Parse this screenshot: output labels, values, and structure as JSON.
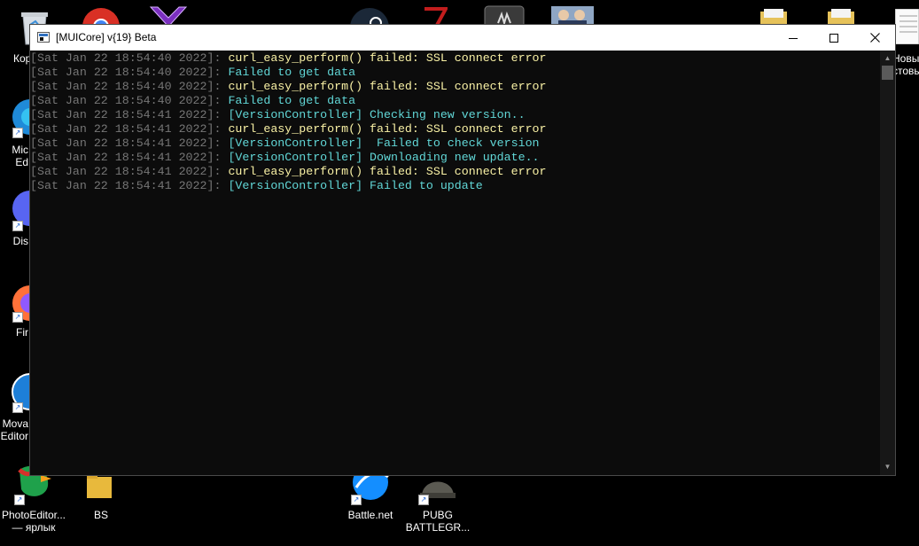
{
  "window": {
    "title": "[MUICore] v{19} Beta"
  },
  "console": {
    "lines": [
      {
        "ts": "[Sat Jan 22 18:54:40 2022]",
        "sep": ": ",
        "msg": "curl_easy_perform() failed: SSL connect error",
        "kind": "warn"
      },
      {
        "ts": "[Sat Jan 22 18:54:40 2022]",
        "sep": ": ",
        "msg": "Failed to get data",
        "kind": "info"
      },
      {
        "ts": "[Sat Jan 22 18:54:40 2022]",
        "sep": ": ",
        "msg": "curl_easy_perform() failed: SSL connect error",
        "kind": "warn"
      },
      {
        "ts": "[Sat Jan 22 18:54:40 2022]",
        "sep": ": ",
        "msg": "Failed to get data",
        "kind": "info"
      },
      {
        "ts": "[Sat Jan 22 18:54:41 2022]",
        "sep": ": ",
        "msg": "[VersionController] Checking new version..",
        "kind": "info"
      },
      {
        "ts": "[Sat Jan 22 18:54:41 2022]",
        "sep": ": ",
        "msg": "curl_easy_perform() failed: SSL connect error",
        "kind": "warn"
      },
      {
        "ts": "[Sat Jan 22 18:54:41 2022]",
        "sep": ": ",
        "msg": "[VersionController]  Failed to check version",
        "kind": "info"
      },
      {
        "ts": "[Sat Jan 22 18:54:41 2022]",
        "sep": ": ",
        "msg": "[VersionController] Downloading new update..",
        "kind": "info"
      },
      {
        "ts": "[Sat Jan 22 18:54:41 2022]",
        "sep": ": ",
        "msg": "curl_easy_perform() failed: SSL connect error",
        "kind": "warn"
      },
      {
        "ts": "[Sat Jan 22 18:54:41 2022]",
        "sep": ": ",
        "msg": "[VersionController] Failed to update",
        "kind": "info"
      }
    ]
  },
  "desktop": {
    "icons": [
      {
        "name": "recycle-bin",
        "label": "Кор"
      },
      {
        "name": "chrome",
        "label": ""
      },
      {
        "name": "app-v",
        "label": ""
      },
      {
        "name": "steam",
        "label": ""
      },
      {
        "name": "app-seven",
        "label": ""
      },
      {
        "name": "app-dark",
        "label": ""
      },
      {
        "name": "anime-game",
        "label": ""
      },
      {
        "name": "folder-1",
        "label": ""
      },
      {
        "name": "folder-2",
        "label": ""
      },
      {
        "name": "new-text-doc",
        "label": "Новы\nстовы"
      },
      {
        "name": "microsoft-edge",
        "label": "Mic\nEd"
      },
      {
        "name": "discord",
        "label": "Dis"
      },
      {
        "name": "firefox",
        "label": "Fir"
      },
      {
        "name": "movavi-editor",
        "label": "Mova\nEditor"
      },
      {
        "name": "photoeditor",
        "label": "PhotoEditor...\n— ярлык"
      },
      {
        "name": "bs-folder",
        "label": "BS"
      },
      {
        "name": "battle-net",
        "label": "Battle.net"
      },
      {
        "name": "pubg",
        "label": "PUBG\nBATTLEGR..."
      }
    ]
  },
  "colors": {
    "info": "#61d6d6",
    "warn": "#f9f1a5",
    "timestamp": "#767676",
    "console_bg": "#0c0c0c"
  }
}
